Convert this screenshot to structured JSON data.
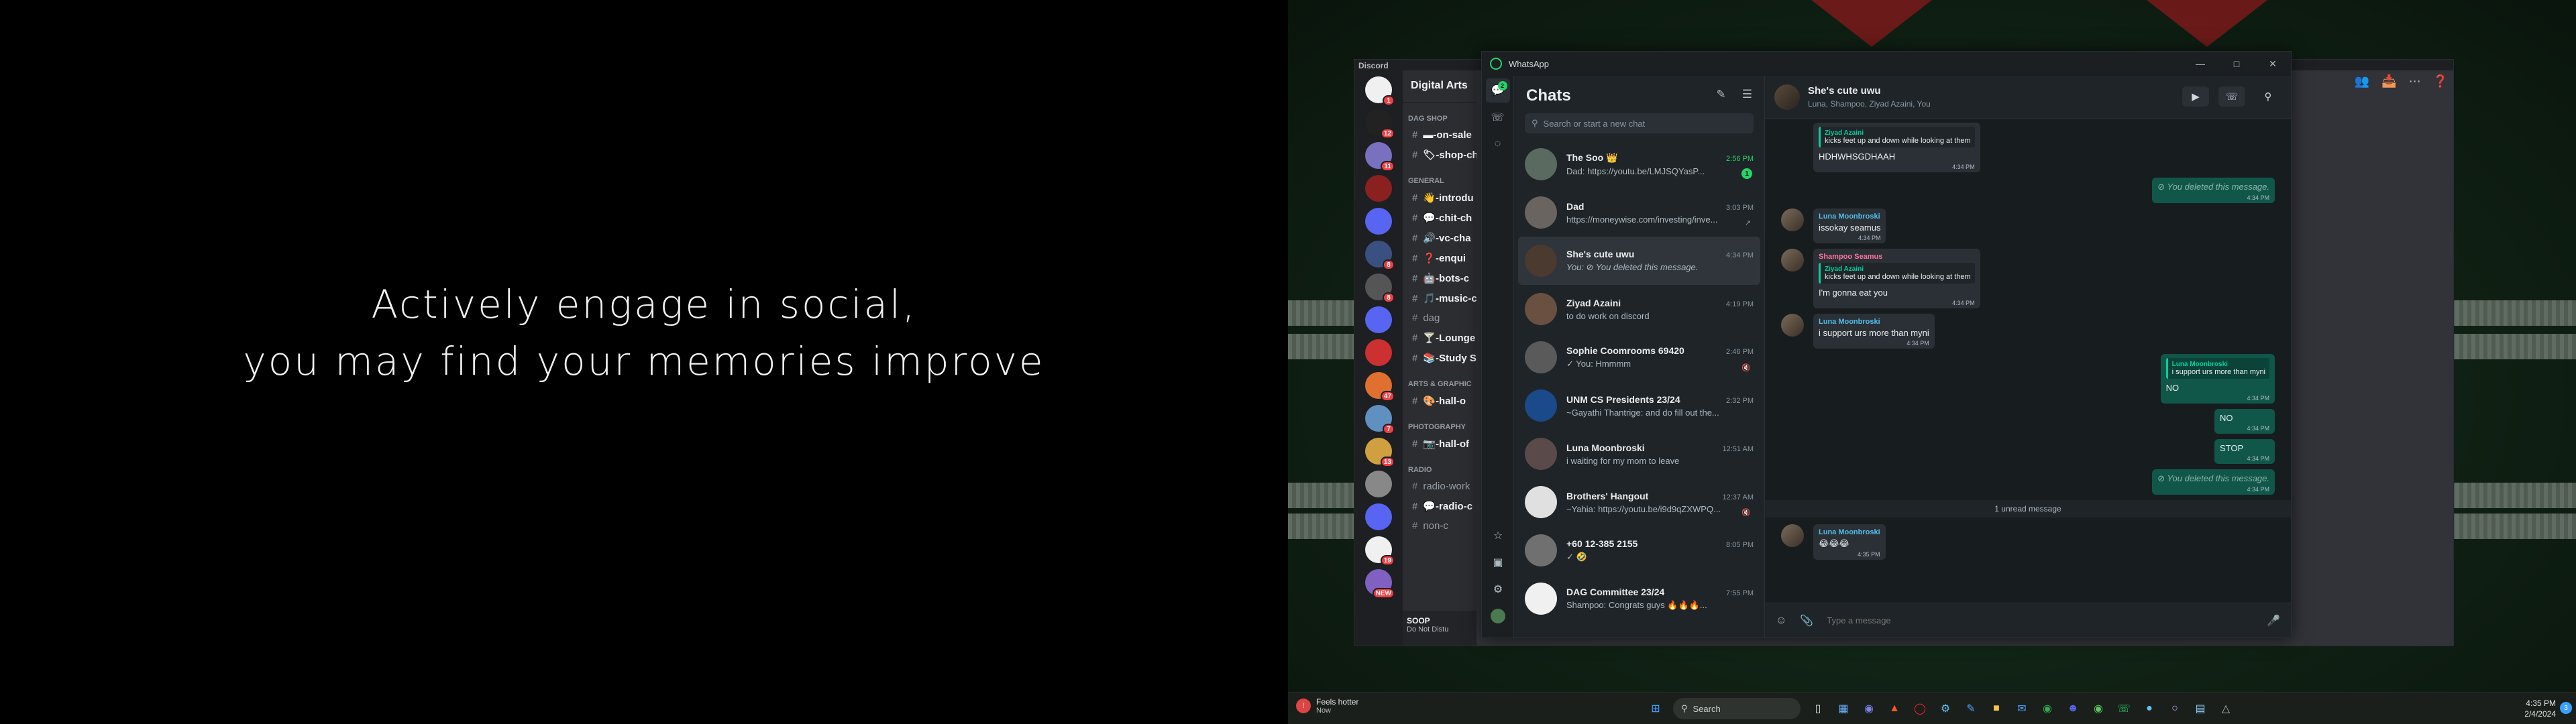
{
  "left_screen": {
    "quote_line1": "Actively engage in social,",
    "quote_line2": "you may find your memories improve"
  },
  "discord": {
    "window_title": "Discord",
    "server_name": "Digital Arts",
    "categories": [
      {
        "label": "DAG SHOP",
        "channels": [
          {
            "icon": "▬",
            "label": "on-sale"
          },
          {
            "icon": "🏷",
            "label": "shop-ch"
          }
        ]
      },
      {
        "label": "GENERAL",
        "channels": [
          {
            "icon": "👋",
            "label": "introdu"
          },
          {
            "icon": "💬",
            "label": "chit-ch"
          },
          {
            "icon": "🔊",
            "label": "vc-cha"
          },
          {
            "icon": "❓",
            "label": "enqui"
          },
          {
            "icon": "🤖",
            "label": "bots-c"
          },
          {
            "icon": "🎵",
            "label": "music-c"
          },
          {
            "icon": "",
            "label": "dag"
          },
          {
            "icon": "🍸",
            "label": "Lounge"
          },
          {
            "icon": "📚",
            "label": "Study S"
          }
        ]
      },
      {
        "label": "ARTS & GRAPHIC",
        "channels": [
          {
            "icon": "🎨",
            "label": "hall-o"
          }
        ]
      },
      {
        "label": "PHOTOGRAPHY",
        "channels": [
          {
            "icon": "📷",
            "label": "hall-of"
          }
        ]
      },
      {
        "label": "RADIO",
        "channels": [
          {
            "icon": "",
            "label": "radio-work"
          },
          {
            "icon": "💬",
            "label": "radio-c"
          },
          {
            "icon": "",
            "label": "non-c"
          }
        ]
      }
    ],
    "guild_badges": [
      "1",
      "12",
      "11",
      "",
      "",
      "8",
      "8",
      "",
      "",
      "47",
      "7",
      "13",
      "",
      "",
      "19",
      "NEW"
    ],
    "user_name": "SOOP",
    "user_status": "Do Not Distu"
  },
  "whatsapp": {
    "window_title": "WhatsApp",
    "rail_badge": "2",
    "chats_title": "Chats",
    "search_placeholder": "Search or start a new chat",
    "chats": [
      {
        "name": "The Soo 👑",
        "time": "2:56 PM",
        "preview": "Dad: https://youtu.be/LMJSQYasP...",
        "time_green": true,
        "badge": "1",
        "avatar": "#5a6a60"
      },
      {
        "name": "Dad",
        "time": "3:03 PM",
        "preview": "https://moneywise.com/investing/inve...",
        "time_green": false,
        "meta": "↗",
        "avatar": "#6a6460"
      },
      {
        "name": "She's cute uwu",
        "time": "4:34 PM",
        "preview": "You: ⊘ You deleted this message.",
        "time_green": false,
        "avatar": "#4a3a30",
        "selected": true,
        "italic": true
      },
      {
        "name": "Ziyad Azaini",
        "time": "4:19 PM",
        "preview": "to do work on discord",
        "time_green": false,
        "avatar": "#6a5040"
      },
      {
        "name": "Sophie Coomrooms 69420",
        "time": "2:46 PM",
        "preview": "✓ You: Hmmmm",
        "time_green": false,
        "meta": "🔇",
        "avatar": "#5a5a5a"
      },
      {
        "name": "UNM CS Presidents 23/24",
        "time": "2:32 PM",
        "preview": "~Gayathi Thantrige: and do fill out the...",
        "time_green": false,
        "avatar": "#1a4a8a"
      },
      {
        "name": "Luna Moonbroski",
        "time": "12:51 AM",
        "preview": "i waiting for my mom to leave",
        "time_green": false,
        "avatar": "#5a4a4a"
      },
      {
        "name": "Brothers' Hangout",
        "time": "12:37 AM",
        "preview": "~Yahia: https://youtu.be/i9d9qZXWPQ...",
        "time_green": false,
        "meta": "🔇",
        "avatar": "#e0e0e0"
      },
      {
        "name": "+60 12-385 2155",
        "time": "8:05 PM",
        "preview": "✓ 🤣",
        "time_green": false,
        "avatar": "#707070"
      },
      {
        "name": "DAG Committee 23/24",
        "time": "7:55 PM",
        "preview": "Shampoo: Congrats guys 🔥🔥🔥...",
        "time_green": false,
        "avatar": "#f0f0f0"
      }
    ],
    "chat_header": {
      "title": "She's cute uwu",
      "subtitle": "Luna, Shampoo, Ziyad Azaini, You"
    },
    "messages": [
      {
        "dir": "in",
        "sender": "",
        "quote_name": "Ziyad Azaini",
        "quote_text": "kicks feet up and down while looking at them",
        "text": "HDHWHSGDHAAH",
        "time": "4:34 PM",
        "avatar": false
      },
      {
        "dir": "out",
        "deleted": true,
        "text": "⊘ You deleted this message.",
        "time": "4:34 PM"
      },
      {
        "dir": "in",
        "sender": "Luna Moonbroski",
        "sender_color": "#53bdeb",
        "text": "issokay seamus",
        "time": "4:34 PM",
        "avatar": true
      },
      {
        "dir": "in",
        "sender": "Shampoo Seamus",
        "sender_color": "#ff72a1",
        "quote_name": "Ziyad Azaini",
        "quote_text": "kicks feet up and down while looking at them",
        "text": "I'm gonna eat you",
        "time": "4:34 PM",
        "avatar": true
      },
      {
        "dir": "in",
        "sender": "Luna Moonbroski",
        "sender_color": "#53bdeb",
        "text": "i support urs more than myni",
        "time": "4:34 PM",
        "avatar": true
      },
      {
        "dir": "out",
        "quote_name": "Luna Moonbroski",
        "quote_text": "i support urs more than myni",
        "text": "NO",
        "time": "4:34 PM"
      },
      {
        "dir": "out",
        "text": "NO",
        "time": "4:34 PM"
      },
      {
        "dir": "out",
        "text": "STOP",
        "time": "4:34 PM"
      },
      {
        "dir": "out",
        "deleted": true,
        "text": "⊘ You deleted this message.",
        "time": "4:34 PM"
      }
    ],
    "unread_label": "1 unread message",
    "last_message": {
      "sender": "Luna Moonbroski",
      "text": "😂😂😂",
      "time": "4:35 PM"
    },
    "input_placeholder": "Type a message"
  },
  "taskbar": {
    "weather_title": "Feels hotter",
    "weather_sub": "Now",
    "search_label": "Search",
    "clock_time": "4:35 PM",
    "clock_date": "2/4/2024",
    "notif_count": "3"
  },
  "colors": {
    "wa_green": "#25d366",
    "wa_out_bubble": "#10574a",
    "discord_blurple": "#5865f2"
  }
}
